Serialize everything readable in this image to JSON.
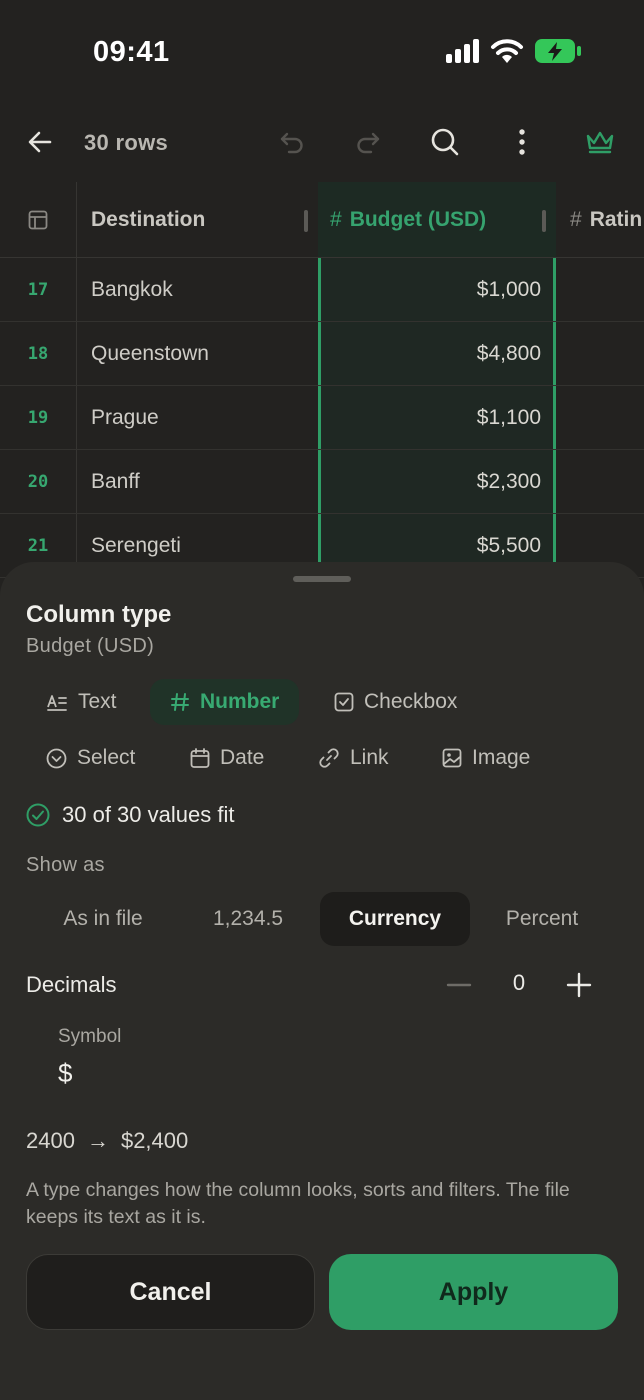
{
  "status": {
    "time": "09:41"
  },
  "toolbar": {
    "rows_label": "30 rows"
  },
  "grid": {
    "headers": {
      "destination": "Destination",
      "budget": "Budget (USD)",
      "rating": "Ratin",
      "hash": "#"
    },
    "rows": [
      {
        "index": "17",
        "destination": "Bangkok",
        "budget": "$1,000"
      },
      {
        "index": "18",
        "destination": "Queenstown",
        "budget": "$4,800"
      },
      {
        "index": "19",
        "destination": "Prague",
        "budget": "$1,100"
      },
      {
        "index": "20",
        "destination": "Banff",
        "budget": "$2,300"
      },
      {
        "index": "21",
        "destination": "Serengeti",
        "budget": "$5,500"
      }
    ]
  },
  "sheet": {
    "title": "Column type",
    "subtitle": "Budget (USD)",
    "types": [
      "Text",
      "Number",
      "Checkbox",
      "Select",
      "Date",
      "Link",
      "Image"
    ],
    "selected_type": "Number",
    "fit_text": "30 of 30 values fit",
    "show_as_label": "Show as",
    "show_as_options": [
      "As in file",
      "1,234.5",
      "Currency",
      "Percent"
    ],
    "show_as_selected": "Currency",
    "decimals_label": "Decimals",
    "decimals_value": "0",
    "symbol_label": "Symbol",
    "symbol_value": "$",
    "example_in": "2400",
    "example_arrow": "→",
    "example_out": "$2,400",
    "note": "A type changes how the column looks, sorts and filters. The file keeps its text as it is.",
    "cancel_label": "Cancel",
    "apply_label": "Apply"
  },
  "colors": {
    "accent": "#2f9e66",
    "background": "#232220",
    "sheet": "#2c2b28"
  }
}
